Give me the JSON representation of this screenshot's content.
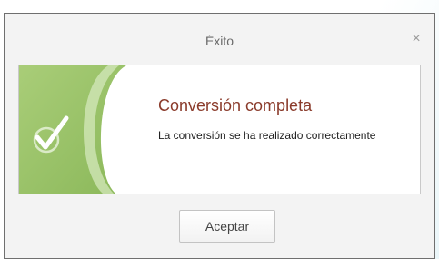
{
  "dialog": {
    "title": "Éxito",
    "close_label": "×",
    "message": {
      "heading": "Conversión completa",
      "body": "La conversión se ha realizado correctamente",
      "icon": "success-check-icon"
    },
    "accept_label": "Aceptar"
  },
  "colors": {
    "dialog_background": "#f3f3f3",
    "panel_background": "#ffffff",
    "heading_color": "#8a3a2a",
    "accent_green": "#9cc36a"
  }
}
